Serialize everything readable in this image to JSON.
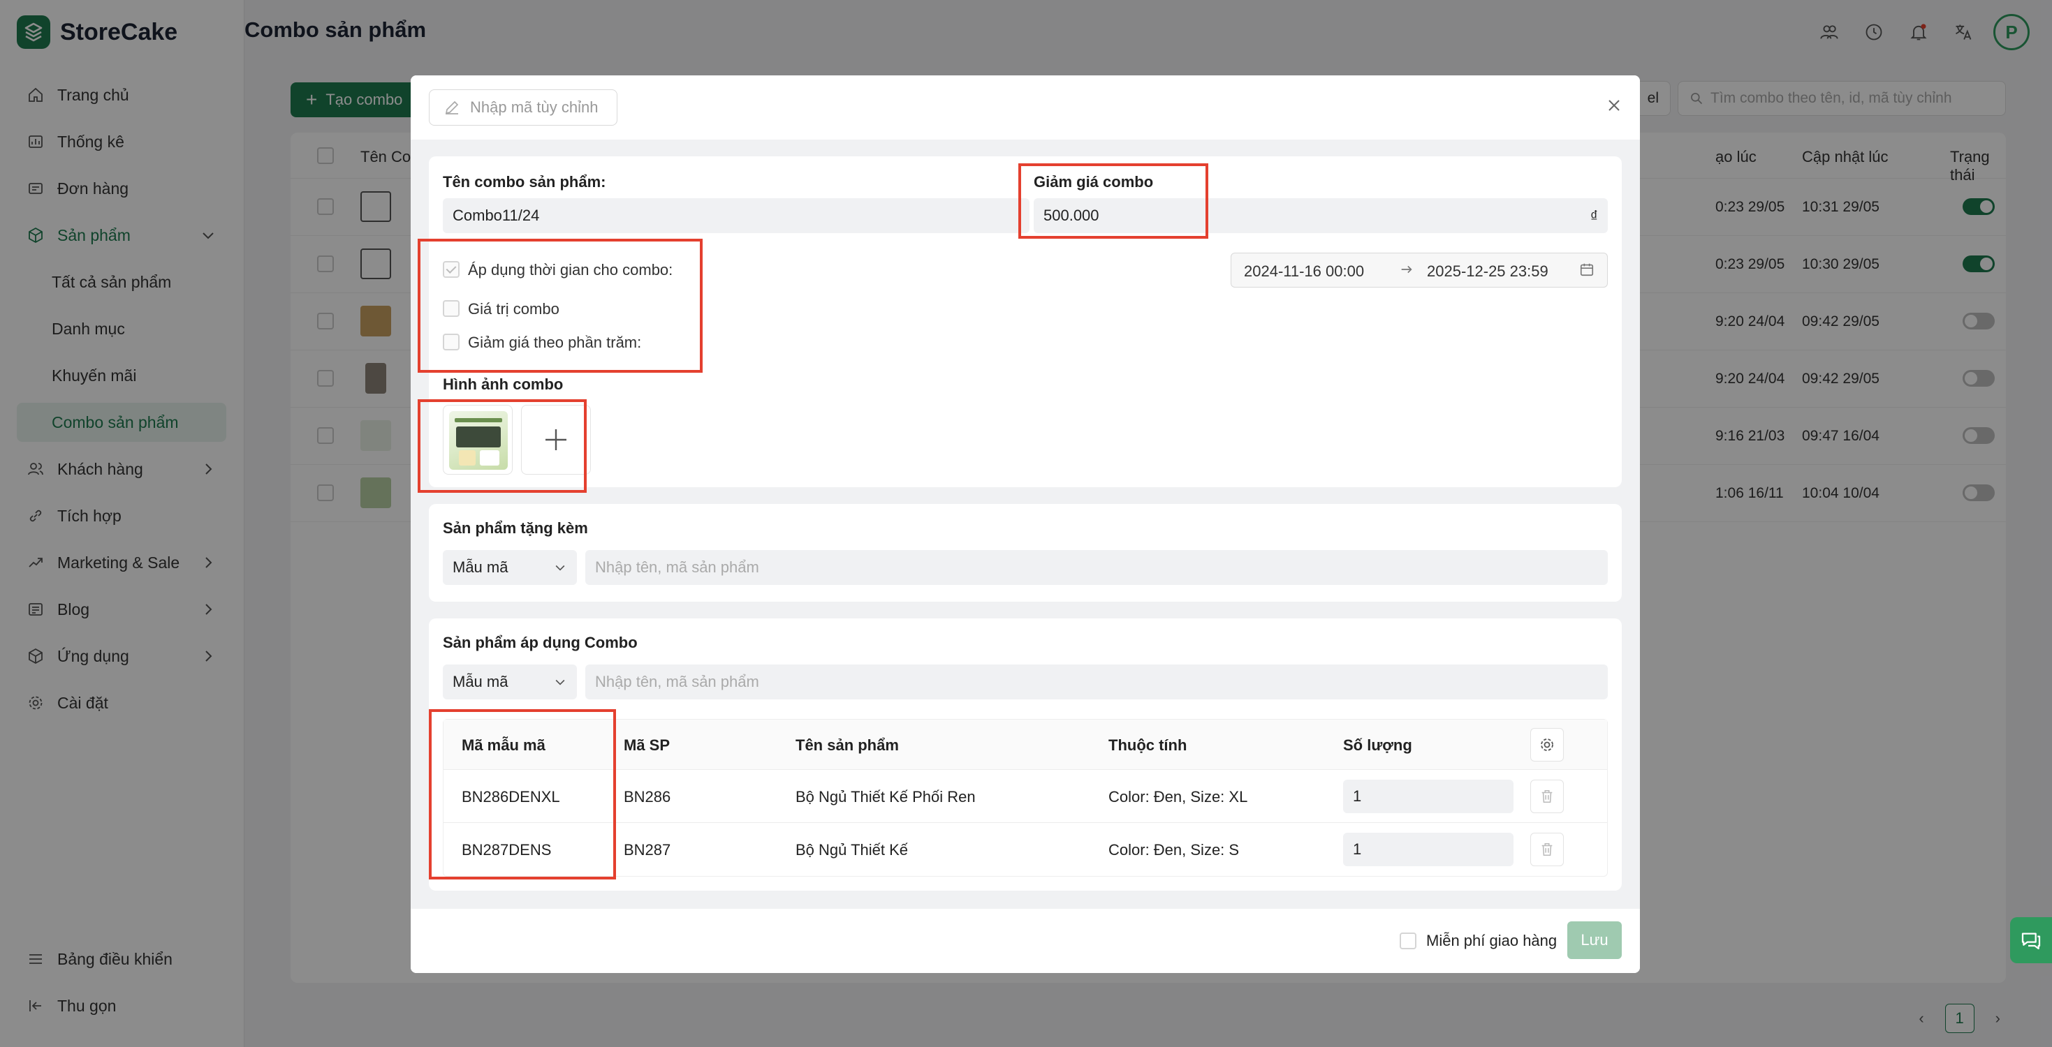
{
  "app": {
    "name": "StoreCake",
    "page_title": "Combo sản phẩm"
  },
  "sidebar": {
    "items": [
      {
        "label": "Trang chủ",
        "icon": "home-icon"
      },
      {
        "label": "Thống kê",
        "icon": "chart-icon"
      },
      {
        "label": "Đơn hàng",
        "icon": "order-icon"
      },
      {
        "label": "Sản phẩm",
        "icon": "box-icon",
        "expanded": true
      },
      {
        "label": "Tất cả sản phẩm"
      },
      {
        "label": "Danh mục"
      },
      {
        "label": "Khuyến mãi"
      },
      {
        "label": "Combo sản phẩm",
        "active": true
      },
      {
        "label": "Khách hàng",
        "icon": "users-icon"
      },
      {
        "label": "Tích hợp",
        "icon": "link-icon"
      },
      {
        "label": "Marketing & Sale",
        "icon": "trend-icon"
      },
      {
        "label": "Blog",
        "icon": "blog-icon"
      },
      {
        "label": "Ứng dụng",
        "icon": "app-icon"
      },
      {
        "label": "Cài đặt",
        "icon": "gear-icon"
      }
    ],
    "bottom": [
      {
        "label": "Bảng điều khiển",
        "icon": "menu-icon"
      },
      {
        "label": "Thu gọn",
        "icon": "collapse-icon"
      }
    ]
  },
  "header": {
    "avatar_letter": "P"
  },
  "background": {
    "create_button": "Tạo combo",
    "excel_button": "el",
    "search_placeholder": "Tìm combo theo tên, id, mã tùy chỉnh",
    "columns": {
      "name": "Tên Co",
      "created": "ạo lúc",
      "updated": "Cập nhật lúc",
      "status": "Trạng thái"
    },
    "rows": [
      {
        "created": "0:23 29/05",
        "updated": "10:31 29/05",
        "active": true
      },
      {
        "created": "0:23 29/05",
        "updated": "10:30 29/05",
        "active": true
      },
      {
        "created": "9:20 24/04",
        "updated": "09:42 29/05",
        "active": false
      },
      {
        "created": "9:20 24/04",
        "updated": "09:42 29/05",
        "active": false
      },
      {
        "created": "9:16 21/03",
        "updated": "09:47 16/04",
        "active": false
      },
      {
        "created": "1:06 16/11",
        "updated": "10:04 10/04",
        "active": false
      }
    ],
    "pagination": {
      "current": "1"
    }
  },
  "modal": {
    "custom_code_placeholder": "Nhập mã tùy chỉnh",
    "combo_name_label": "Tên combo sản phẩm:",
    "combo_name_value": "Combo11/24",
    "discount_label": "Giảm giá combo",
    "discount_value": "500.000",
    "currency": "₫",
    "apply_time_label": "Áp dụng thời gian cho combo:",
    "combo_value_label": "Giá trị combo",
    "percent_discount_label": "Giảm giá theo phần trăm:",
    "date_start": "2024-11-16 00:00",
    "date_end": "2025-12-25 23:59",
    "image_label": "Hình ảnh combo",
    "gift_section_title": "Sản phẩm tặng kèm",
    "apply_section_title": "Sản phẩm áp dụng Combo",
    "variant_select": "Mẫu mã",
    "product_search_placeholder": "Nhập tên, mã sản phẩm",
    "table": {
      "headers": {
        "variant_code": "Mã mẫu mã",
        "sku": "Mã SP",
        "name": "Tên sản phẩm",
        "attrs": "Thuộc tính",
        "qty": "Số lượng"
      },
      "rows": [
        {
          "variant_code": "BN286DENXL",
          "sku": "BN286",
          "name": "Bộ Ngủ Thiết Kế Phối Ren",
          "attrs": "Color: Đen, Size: XL",
          "qty": "1"
        },
        {
          "variant_code": "BN287DENS",
          "sku": "BN287",
          "name": "Bộ Ngủ Thiết Kế",
          "attrs": "Color: Đen, Size: S",
          "qty": "1"
        }
      ]
    },
    "free_shipping_label": "Miễn phí giao hàng",
    "save_label": "Lưu"
  },
  "colors": {
    "brand": "#1e7a4f",
    "highlight": "#e4402f",
    "save_disabled": "#9fcab0"
  }
}
